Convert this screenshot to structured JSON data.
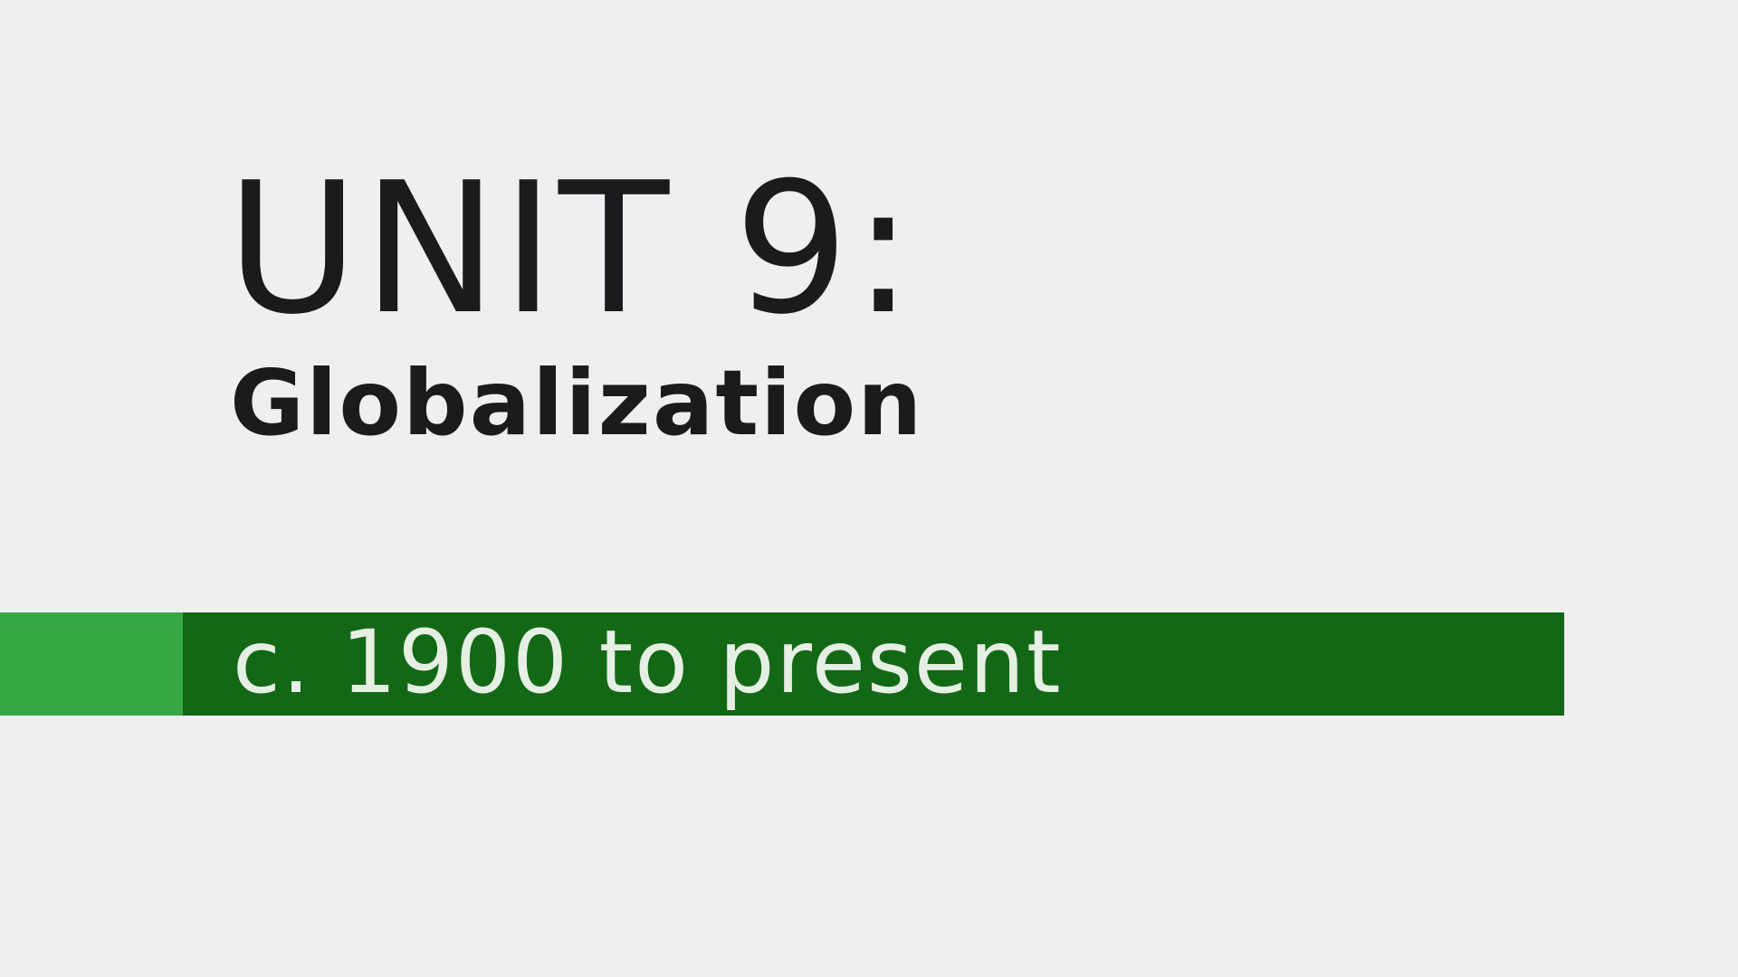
{
  "slide": {
    "title": "UNIT 9:",
    "subtitle": "Globalization",
    "date_range": "c. 1900 to present"
  },
  "colors": {
    "background": "#efeef0",
    "text": "#1b1a1d",
    "band_accent": "#34a843",
    "band_main": "#136815",
    "band_text": "#e6efe4"
  }
}
